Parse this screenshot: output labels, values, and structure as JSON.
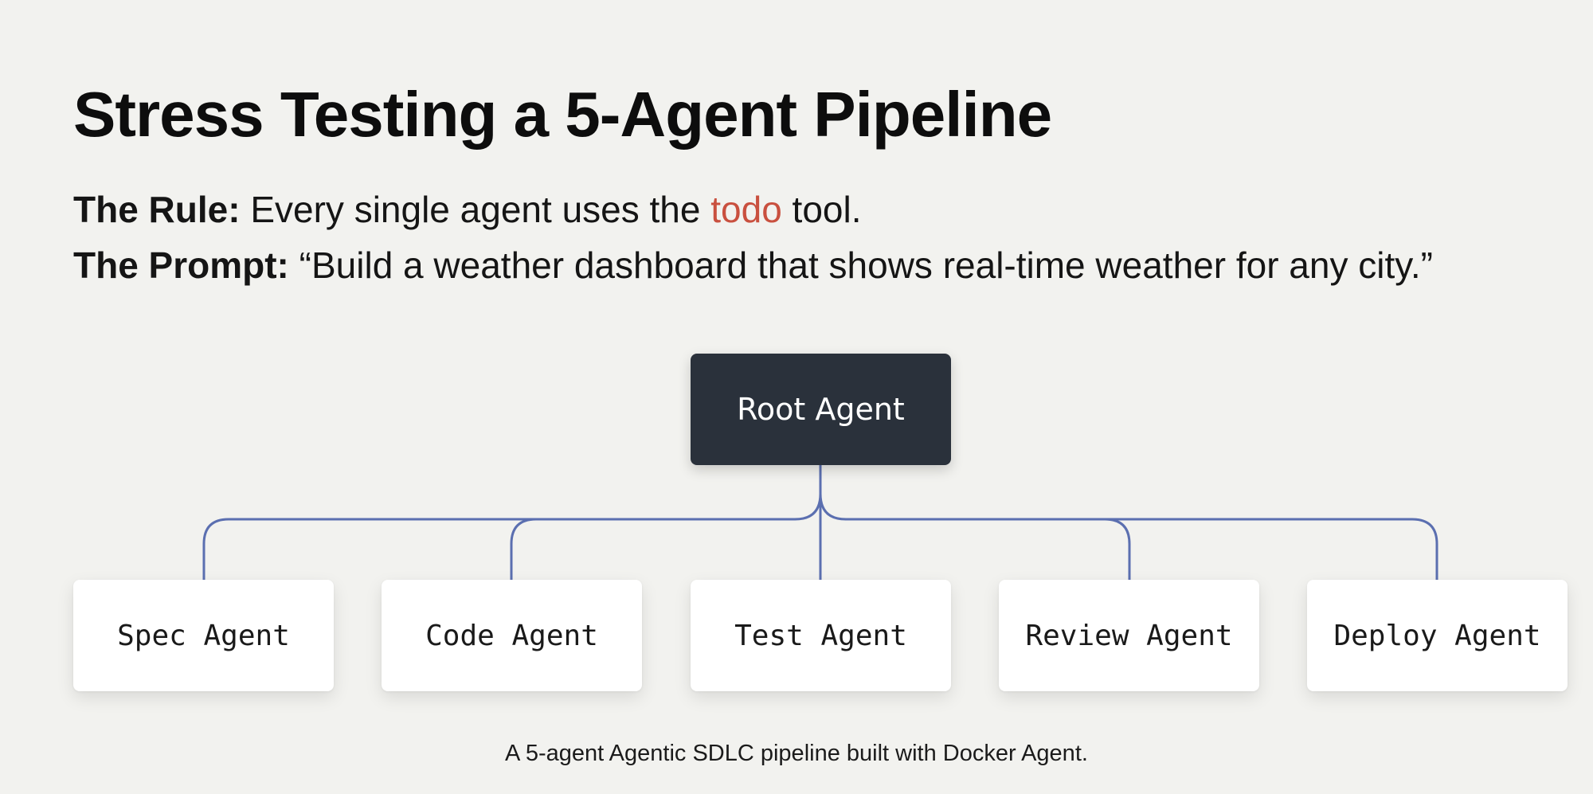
{
  "title": "Stress Testing a 5-Agent Pipeline",
  "rule": {
    "label": "The Rule:",
    "text_before": " Every single agent uses the ",
    "highlight": "todo",
    "text_after": " tool."
  },
  "prompt": {
    "label": "The Prompt:",
    "text": " “Build a weather dashboard that shows real-time weather for any city.”"
  },
  "diagram": {
    "root": {
      "label": "Root Agent"
    },
    "children": [
      {
        "label": "Spec Agent"
      },
      {
        "label": "Code Agent"
      },
      {
        "label": "Test Agent"
      },
      {
        "label": "Review Agent"
      },
      {
        "label": "Deploy Agent"
      }
    ]
  },
  "caption": "A 5-agent Agentic SDLC pipeline built with Docker Agent.",
  "colors": {
    "background": "#f2f2ef",
    "root_fill": "#2a313b",
    "child_fill": "#ffffff",
    "connector": "#5b6fb0",
    "highlight": "#c9503f"
  }
}
